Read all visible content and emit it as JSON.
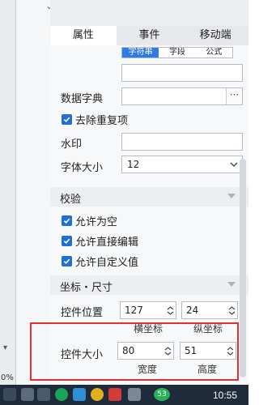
{
  "tabs": [
    {
      "label": "属性",
      "active": true
    },
    {
      "label": "事件",
      "active": false
    },
    {
      "label": "移动端",
      "active": false
    }
  ],
  "segments": [
    "字符串",
    "字段",
    "公式"
  ],
  "data_dict": {
    "label": "数据字典",
    "button": "···"
  },
  "dedupe": {
    "label": "去除重复项",
    "checked": true
  },
  "watermark": {
    "label": "水印",
    "value": ""
  },
  "font_size": {
    "label": "字体大小",
    "value": "12"
  },
  "validation": {
    "header": "校验",
    "allow_empty": "允许为空",
    "allow_direct_edit": "允许直接编辑",
    "allow_custom_value": "允许自定义值"
  },
  "coords": {
    "header": "坐标・尺寸",
    "position_label": "控件位置",
    "x_value": "127",
    "y_value": "24",
    "x_caption": "横坐标",
    "y_caption": "纵坐标",
    "size_label": "控件大小",
    "width_value": "80",
    "height_value": "51",
    "width_caption": "宽度",
    "height_caption": "高度"
  },
  "left_strip": {
    "percent": "0%"
  },
  "taskbar": {
    "time": "10:55",
    "badge": "53"
  },
  "colors": {
    "accent": "#1f6fd6",
    "highlight_box": "#e03030",
    "taskbar": "#1f2b3a"
  }
}
